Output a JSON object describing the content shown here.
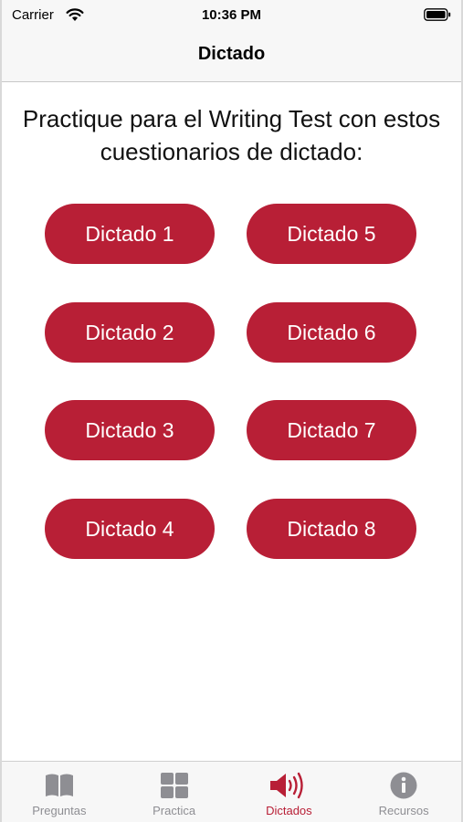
{
  "status_bar": {
    "carrier": "Carrier",
    "time": "10:36 PM",
    "icons": [
      "wifi-icon",
      "battery-icon"
    ]
  },
  "nav": {
    "title": "Dictado"
  },
  "intro": {
    "text": "Practique para el Writing Test con estos cuestionarios de dictado:"
  },
  "buttons": {
    "d1": "Dictado 1",
    "d2": "Dictado 2",
    "d3": "Dictado 3",
    "d4": "Dictado 4",
    "d5": "Dictado 5",
    "d6": "Dictado 6",
    "d7": "Dictado 7",
    "d8": "Dictado 8"
  },
  "tabs": [
    {
      "label": "Preguntas",
      "icon": "book-icon",
      "active": false
    },
    {
      "label": "Practica",
      "icon": "grid-icon",
      "active": false
    },
    {
      "label": "Dictados",
      "icon": "speaker-icon",
      "active": true
    },
    {
      "label": "Recursos",
      "icon": "info-icon",
      "active": false
    }
  ],
  "colors": {
    "accent": "#b81f36",
    "tab_inactive": "#8e8e93",
    "bar_background": "#f7f7f7"
  }
}
